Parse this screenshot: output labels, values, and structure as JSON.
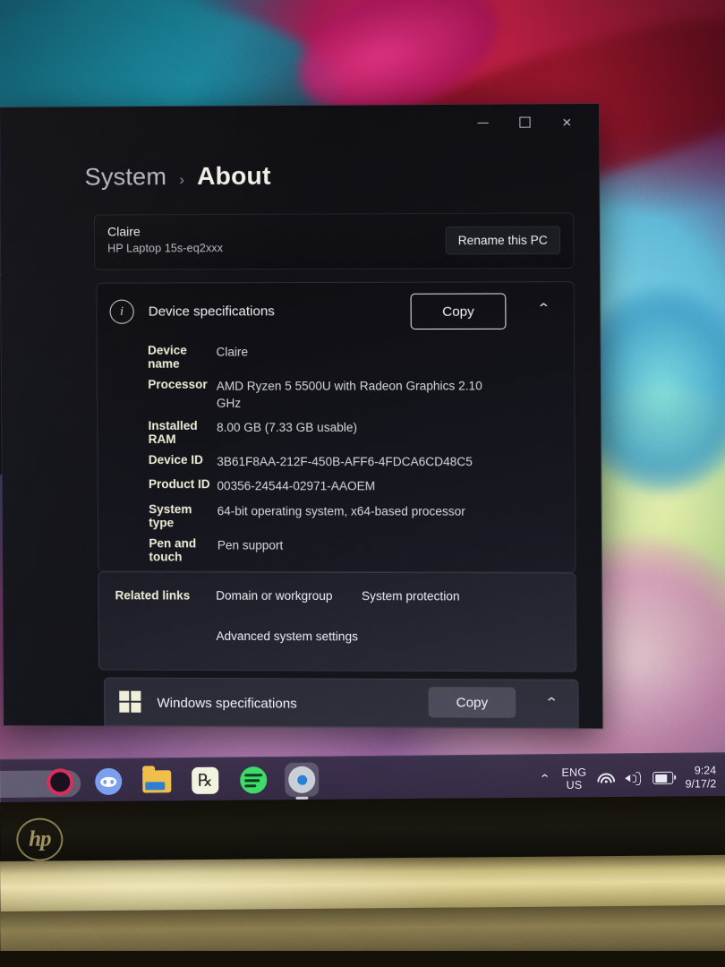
{
  "window": {
    "controls": {
      "minimize": "–",
      "maximize": "□",
      "close": "✕"
    }
  },
  "breadcrumb": {
    "parent": "System",
    "separator": "›",
    "current": "About"
  },
  "device_card": {
    "name": "Claire",
    "model": "HP Laptop 15s-eq2xxx",
    "rename_label": "Rename this PC"
  },
  "device_specifications": {
    "title": "Device specifications",
    "copy_label": "Copy",
    "collapse_glyph": "⌃",
    "rows": [
      {
        "label": "Device name",
        "value": "Claire"
      },
      {
        "label": "Processor",
        "value": "AMD Ryzen 5 5500U with Radeon Graphics 2.10 GHz"
      },
      {
        "label": "Installed RAM",
        "value": "8.00 GB (7.33 GB usable)"
      },
      {
        "label": "Device ID",
        "value": "3B61F8AA-212F-450B-AFF6-4FDCA6CD48C5"
      },
      {
        "label": "Product ID",
        "value": "00356-24544-02971-AAOEM"
      },
      {
        "label": "System type",
        "value": "64-bit operating system, x64-based processor"
      },
      {
        "label": "Pen and touch",
        "value": "Pen support"
      }
    ]
  },
  "related_links": {
    "label": "Related links",
    "links": [
      "Domain or workgroup",
      "System protection",
      "Advanced system settings"
    ]
  },
  "windows_specifications": {
    "title": "Windows specifications",
    "copy_label": "Copy",
    "collapse_glyph": "⌃"
  },
  "taskbar": {
    "apps": [
      "opera-icon",
      "discord-icon",
      "file-explorer-icon",
      "quest-app-icon",
      "spotify-icon",
      "settings-gear-icon"
    ],
    "tray": {
      "overflow_glyph": "⌃",
      "language_line1": "ENG",
      "language_line2": "US",
      "time": "9:24",
      "date": "9/17/2"
    }
  },
  "laptop": {
    "brand": "hp"
  },
  "colors": {
    "accent_blue": "#2b7fd6",
    "card_dark": "#0d0d11",
    "card_light": "#2b2b38",
    "label_cream": "#efefd8",
    "text_primary": "#efeff4",
    "taskbar": "#342c46"
  }
}
